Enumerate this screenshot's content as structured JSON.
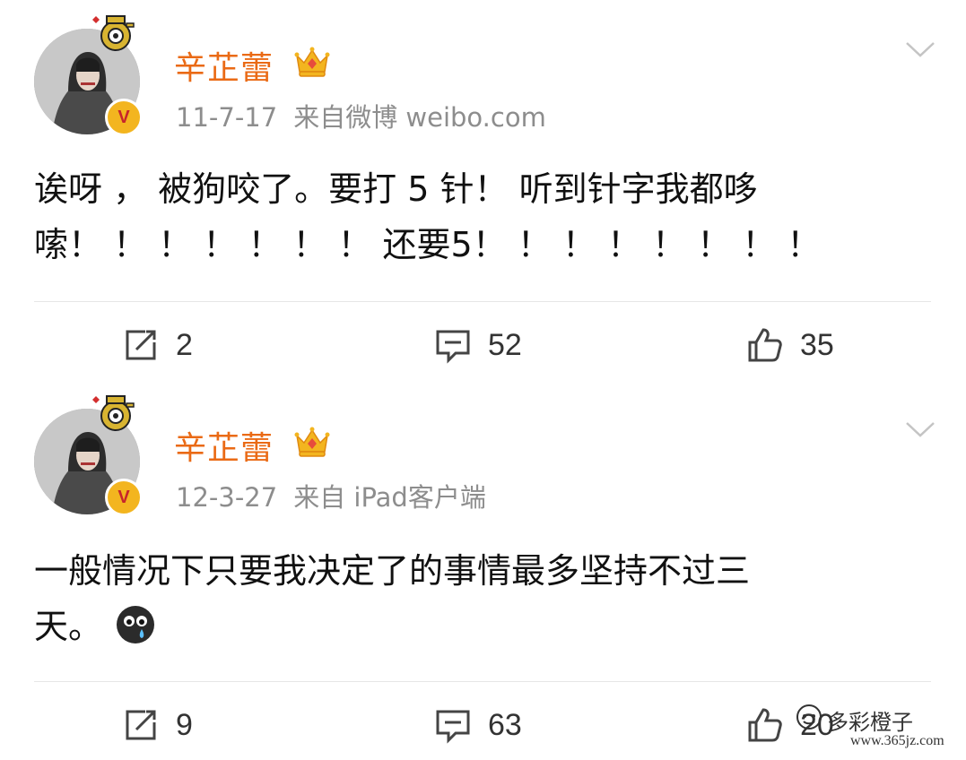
{
  "posts": [
    {
      "username": "辛芷蕾",
      "date": "11-7-17",
      "source": "来自微博 weibo.com",
      "text_line1": "诶呀 ， 被狗咬了。要打 5 针！ 听到针字我都哆",
      "text_line2": "嗦！ ！ ！ ！ ！ ！ ！ 还要5！ ！ ！ ！ ！ ！ ！ ！",
      "repost_count": "2",
      "comment_count": "52",
      "like_count": "35"
    },
    {
      "username": "辛芷蕾",
      "date": "12-3-27",
      "source": "来自 iPad客户端",
      "text_line1": "一般情况下只要我决定了的事情最多坚持不过三",
      "text_line2": "天。",
      "repost_count": "9",
      "comment_count": "63",
      "like_count": "20"
    }
  ],
  "watermark": {
    "name": "多彩橙子",
    "url": "www.365jz.com"
  },
  "icons": {
    "verified_badge": "verified-v-icon",
    "crown": "crown-icon",
    "chevron": "chevron-down-icon",
    "repost": "repost-icon",
    "comment": "comment-icon",
    "like": "thumbs-up-icon",
    "emoji": "crying-emoji-icon"
  },
  "colors": {
    "username": "#ea6a15",
    "meta": "#8d8d8d",
    "badge": "#f3b51f",
    "badge_v": "#c7242b"
  }
}
